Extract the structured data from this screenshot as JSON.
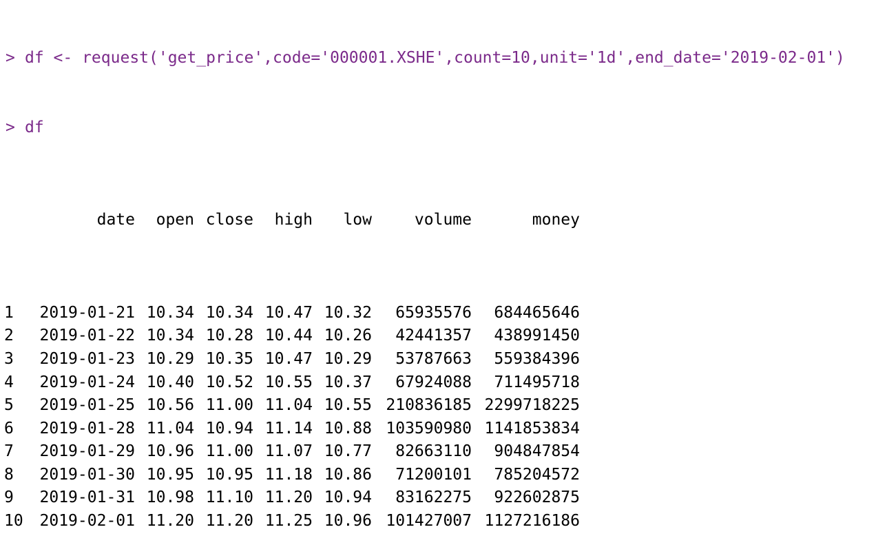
{
  "console": {
    "prompt_symbol": ">",
    "command_1": "df <- request('get_price',code='000001.XSHE',count=10,unit='1d',end_date='2019-02-01')",
    "command_2": "df"
  },
  "table": {
    "columns": [
      "",
      "date",
      "open",
      "close",
      "high",
      "low",
      "volume",
      "money"
    ],
    "rows": [
      [
        "1",
        "2019-01-21",
        "10.34",
        "10.34",
        "10.47",
        "10.32",
        "65935576",
        "684465646"
      ],
      [
        "2",
        "2019-01-22",
        "10.34",
        "10.28",
        "10.44",
        "10.26",
        "42441357",
        "438991450"
      ],
      [
        "3",
        "2019-01-23",
        "10.29",
        "10.35",
        "10.47",
        "10.29",
        "53787663",
        "559384396"
      ],
      [
        "4",
        "2019-01-24",
        "10.40",
        "10.52",
        "10.55",
        "10.37",
        "67924088",
        "711495718"
      ],
      [
        "5",
        "2019-01-25",
        "10.56",
        "11.00",
        "11.04",
        "10.55",
        "210836185",
        "2299718225"
      ],
      [
        "6",
        "2019-01-28",
        "11.04",
        "10.94",
        "11.14",
        "10.88",
        "103590980",
        "1141853834"
      ],
      [
        "7",
        "2019-01-29",
        "10.96",
        "11.00",
        "11.07",
        "10.77",
        "82663110",
        "904847854"
      ],
      [
        "8",
        "2019-01-30",
        "10.95",
        "10.95",
        "11.18",
        "10.86",
        "71200101",
        "785204572"
      ],
      [
        "9",
        "2019-01-31",
        "10.98",
        "11.10",
        "11.20",
        "10.94",
        "83162275",
        "922602875"
      ],
      [
        "10",
        "2019-02-01",
        "11.20",
        "11.20",
        "11.25",
        "10.96",
        "101427007",
        "1127216186"
      ]
    ]
  },
  "colors": {
    "command": "#7b2a8a",
    "output": "#000000",
    "background": "#ffffff"
  }
}
